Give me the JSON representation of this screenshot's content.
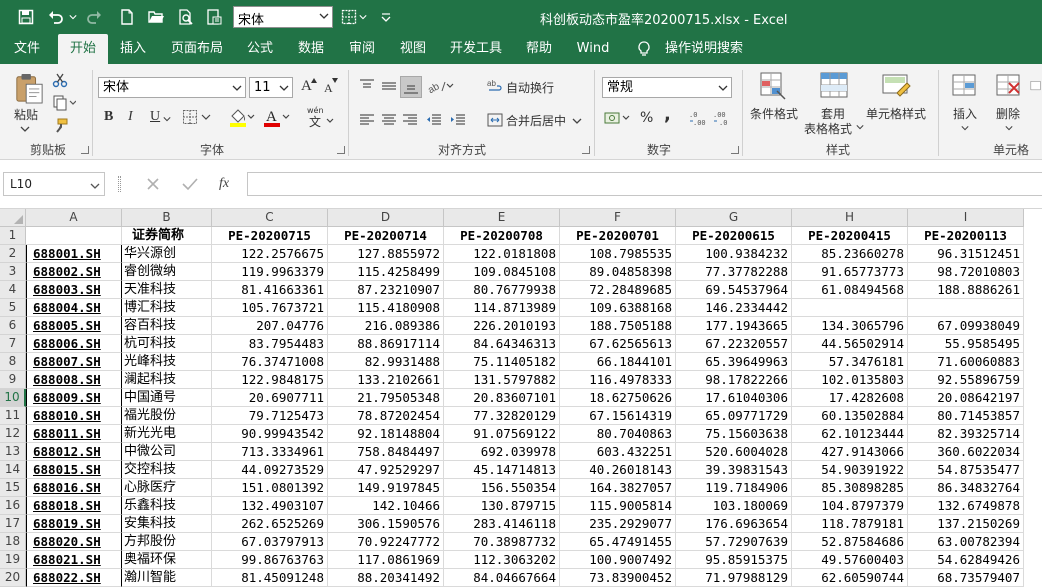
{
  "window": {
    "title": "科创板动态市盈率20200715.xlsx  -  Excel",
    "quick_font": "宋体"
  },
  "tabs": [
    "文件",
    "开始",
    "插入",
    "页面布局",
    "公式",
    "数据",
    "审阅",
    "视图",
    "开发工具",
    "帮助",
    "Wind",
    "操作说明搜索"
  ],
  "active_tab": "开始",
  "ribbon": {
    "clipboard": {
      "paste_label": "粘贴",
      "group_label": "剪贴板"
    },
    "font": {
      "font_name": "宋体",
      "font_size": "11",
      "bold": "B",
      "italic": "I",
      "grow": "A",
      "shrink": "A",
      "underline": "U",
      "phonetic": "wén",
      "group_label": "字体"
    },
    "alignment": {
      "wrap_text": "自动换行",
      "merge_center": "合并后居中",
      "group_label": "对齐方式"
    },
    "number": {
      "format": "常规",
      "percent": "%",
      "comma": ",",
      "group_label": "数字"
    },
    "styles": {
      "conditional": "条件格式",
      "table_format_1": "套用",
      "table_format_2": "表格格式",
      "cell_styles": "单元格样式",
      "group_label": "样式"
    },
    "cells": {
      "insert": "插入",
      "delete": "删除",
      "group_label": "单元格"
    }
  },
  "formula_bar": {
    "name_box": "L10",
    "fx": "fx",
    "content": ""
  },
  "sheet": {
    "columns": [
      "A",
      "B",
      "C",
      "D",
      "E",
      "F",
      "G",
      "H",
      "I"
    ],
    "header_row": [
      "",
      "证券简称",
      "PE-20200715",
      "PE-20200714",
      "PE-20200708",
      "PE-20200701",
      "PE-20200615",
      "PE-20200415",
      "PE-20200113"
    ],
    "selected_row": "10",
    "rows": [
      [
        "688001.SH",
        "华兴源创",
        "122.2576675",
        "127.8855972",
        "122.0181808",
        "108.7985535",
        "100.9384232",
        "85.23660278",
        "96.31512451"
      ],
      [
        "688002.SH",
        "睿创微纳",
        "119.9963379",
        "115.4258499",
        "109.0845108",
        "89.04858398",
        "77.37782288",
        "91.65773773",
        "98.72010803"
      ],
      [
        "688003.SH",
        "天准科技",
        "81.41663361",
        "87.23210907",
        "80.76779938",
        "72.28489685",
        "69.54537964",
        "61.08494568",
        "188.8886261"
      ],
      [
        "688004.SH",
        "博汇科技",
        "105.7673721",
        "115.4180908",
        "114.8713989",
        "109.6388168",
        "146.2334442",
        "",
        ""
      ],
      [
        "688005.SH",
        "容百科技",
        "207.04776",
        "216.089386",
        "226.2010193",
        "188.7505188",
        "177.1943665",
        "134.3065796",
        "67.09938049"
      ],
      [
        "688006.SH",
        "杭可科技",
        "83.7954483",
        "88.86917114",
        "84.64346313",
        "67.62565613",
        "67.22320557",
        "44.56502914",
        "55.9585495"
      ],
      [
        "688007.SH",
        "光峰科技",
        "76.37471008",
        "82.9931488",
        "75.11405182",
        "66.1844101",
        "65.39649963",
        "57.3476181",
        "71.60060883"
      ],
      [
        "688008.SH",
        "澜起科技",
        "122.9848175",
        "133.2102661",
        "131.5797882",
        "116.4978333",
        "98.17822266",
        "102.0135803",
        "92.55896759"
      ],
      [
        "688009.SH",
        "中国通号",
        "20.6907711",
        "21.79505348",
        "20.83607101",
        "18.62750626",
        "17.61040306",
        "17.4282608",
        "20.08642197"
      ],
      [
        "688010.SH",
        "福光股份",
        "79.7125473",
        "78.87202454",
        "77.32820129",
        "67.15614319",
        "65.09771729",
        "60.13502884",
        "80.71453857"
      ],
      [
        "688011.SH",
        "新光光电",
        "90.99943542",
        "92.18148804",
        "91.07569122",
        "80.7040863",
        "75.15603638",
        "62.10123444",
        "82.39325714"
      ],
      [
        "688012.SH",
        "中微公司",
        "713.3334961",
        "758.8484497",
        "692.039978",
        "603.432251",
        "520.6004028",
        "427.9143066",
        "360.6022034"
      ],
      [
        "688015.SH",
        "交控科技",
        "44.09273529",
        "47.92529297",
        "45.14714813",
        "40.26018143",
        "39.39831543",
        "54.90391922",
        "54.87535477"
      ],
      [
        "688016.SH",
        "心脉医疗",
        "151.0801392",
        "149.9197845",
        "156.550354",
        "164.3827057",
        "119.7184906",
        "85.30898285",
        "86.34832764"
      ],
      [
        "688018.SH",
        "乐鑫科技",
        "132.4903107",
        "142.10466",
        "130.879715",
        "115.9005814",
        "103.180069",
        "104.8797379",
        "132.6749878"
      ],
      [
        "688019.SH",
        "安集科技",
        "262.6525269",
        "306.1590576",
        "283.4146118",
        "235.2929077",
        "176.6963654",
        "118.7879181",
        "137.2150269"
      ],
      [
        "688020.SH",
        "方邦股份",
        "67.03797913",
        "70.92247772",
        "70.38987732",
        "65.47491455",
        "57.72907639",
        "52.87584686",
        "63.00782394"
      ],
      [
        "688021.SH",
        "奥福环保",
        "99.86763763",
        "117.0861969",
        "112.3063202",
        "100.9007492",
        "95.85915375",
        "49.57600403",
        "54.62849426"
      ],
      [
        "688022.SH",
        "瀚川智能",
        "81.45091248",
        "88.20341492",
        "84.04667664",
        "73.83900452",
        "71.97988129",
        "62.60590744",
        "68.73579407"
      ]
    ]
  }
}
